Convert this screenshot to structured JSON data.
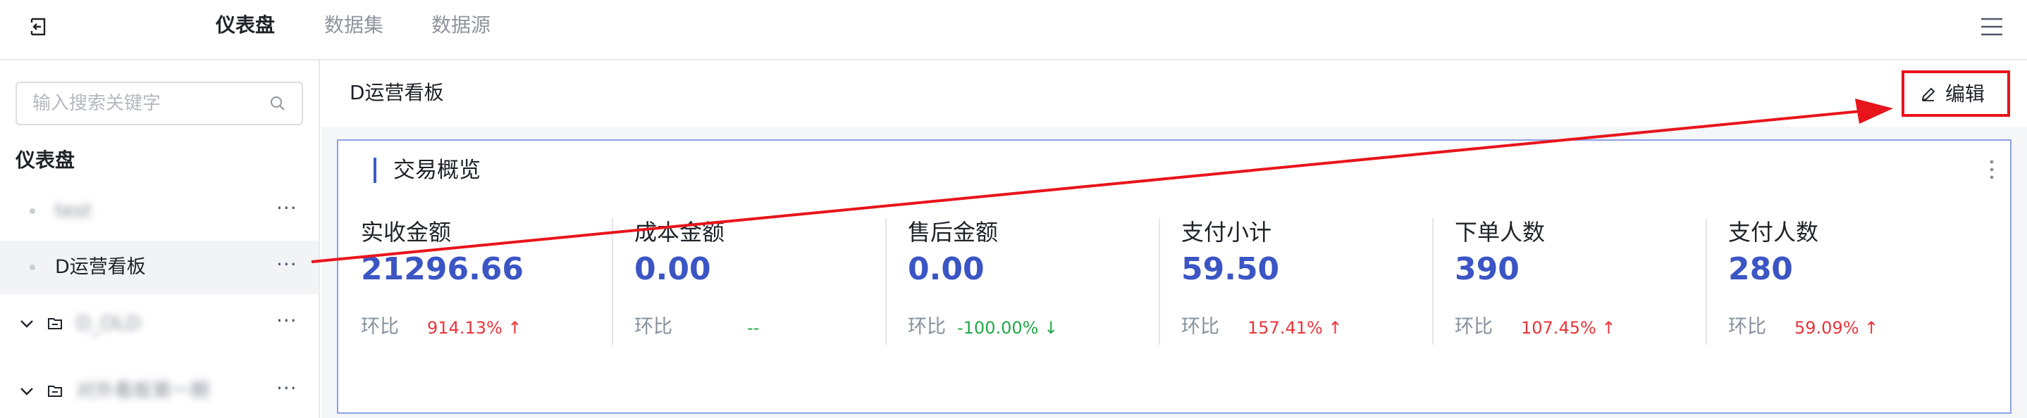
{
  "topnav": {
    "tabs": [
      {
        "label": "仪表盘",
        "active": true
      },
      {
        "label": "数据集",
        "active": false
      },
      {
        "label": "数据源",
        "active": false
      }
    ]
  },
  "sidebar": {
    "search_placeholder": "输入搜索关键字",
    "section_title": "仪表盘",
    "items": [
      {
        "label": "test",
        "blurred": true,
        "more": "···"
      },
      {
        "label": "D运营看板",
        "selected": true,
        "more": "···"
      },
      {
        "label": "D_OLD",
        "blurred": true,
        "folder": true,
        "more": "···"
      },
      {
        "label": "对外看板第一期",
        "blurred": true,
        "folder": true,
        "more": "···"
      }
    ]
  },
  "main": {
    "board_title": "D运营看板",
    "edit_label": "编辑",
    "card": {
      "title": "交易概览",
      "metrics": [
        {
          "name": "实收金额",
          "value": "21296.66",
          "compare_label": "环比",
          "change": "914.13%",
          "trend": "up"
        },
        {
          "name": "成本金额",
          "value": "0.00",
          "compare_label": "环比",
          "change": "--",
          "trend": "flat"
        },
        {
          "name": "售后金额",
          "value": "0.00",
          "compare_label": "环比",
          "change": "-100.00%",
          "trend": "down"
        },
        {
          "name": "支付小计",
          "value": "59.50",
          "compare_label": "环比",
          "change": "157.41%",
          "trend": "up"
        },
        {
          "name": "下单人数",
          "value": "390",
          "compare_label": "环比",
          "change": "107.45%",
          "trend": "up"
        },
        {
          "name": "支付人数",
          "value": "280",
          "compare_label": "环比",
          "change": "59.09%",
          "trend": "up"
        }
      ]
    }
  },
  "colors": {
    "accent": "#3b55c4",
    "up": "#e8353b",
    "down": "#22a94a",
    "annotation": "#e8141b"
  }
}
